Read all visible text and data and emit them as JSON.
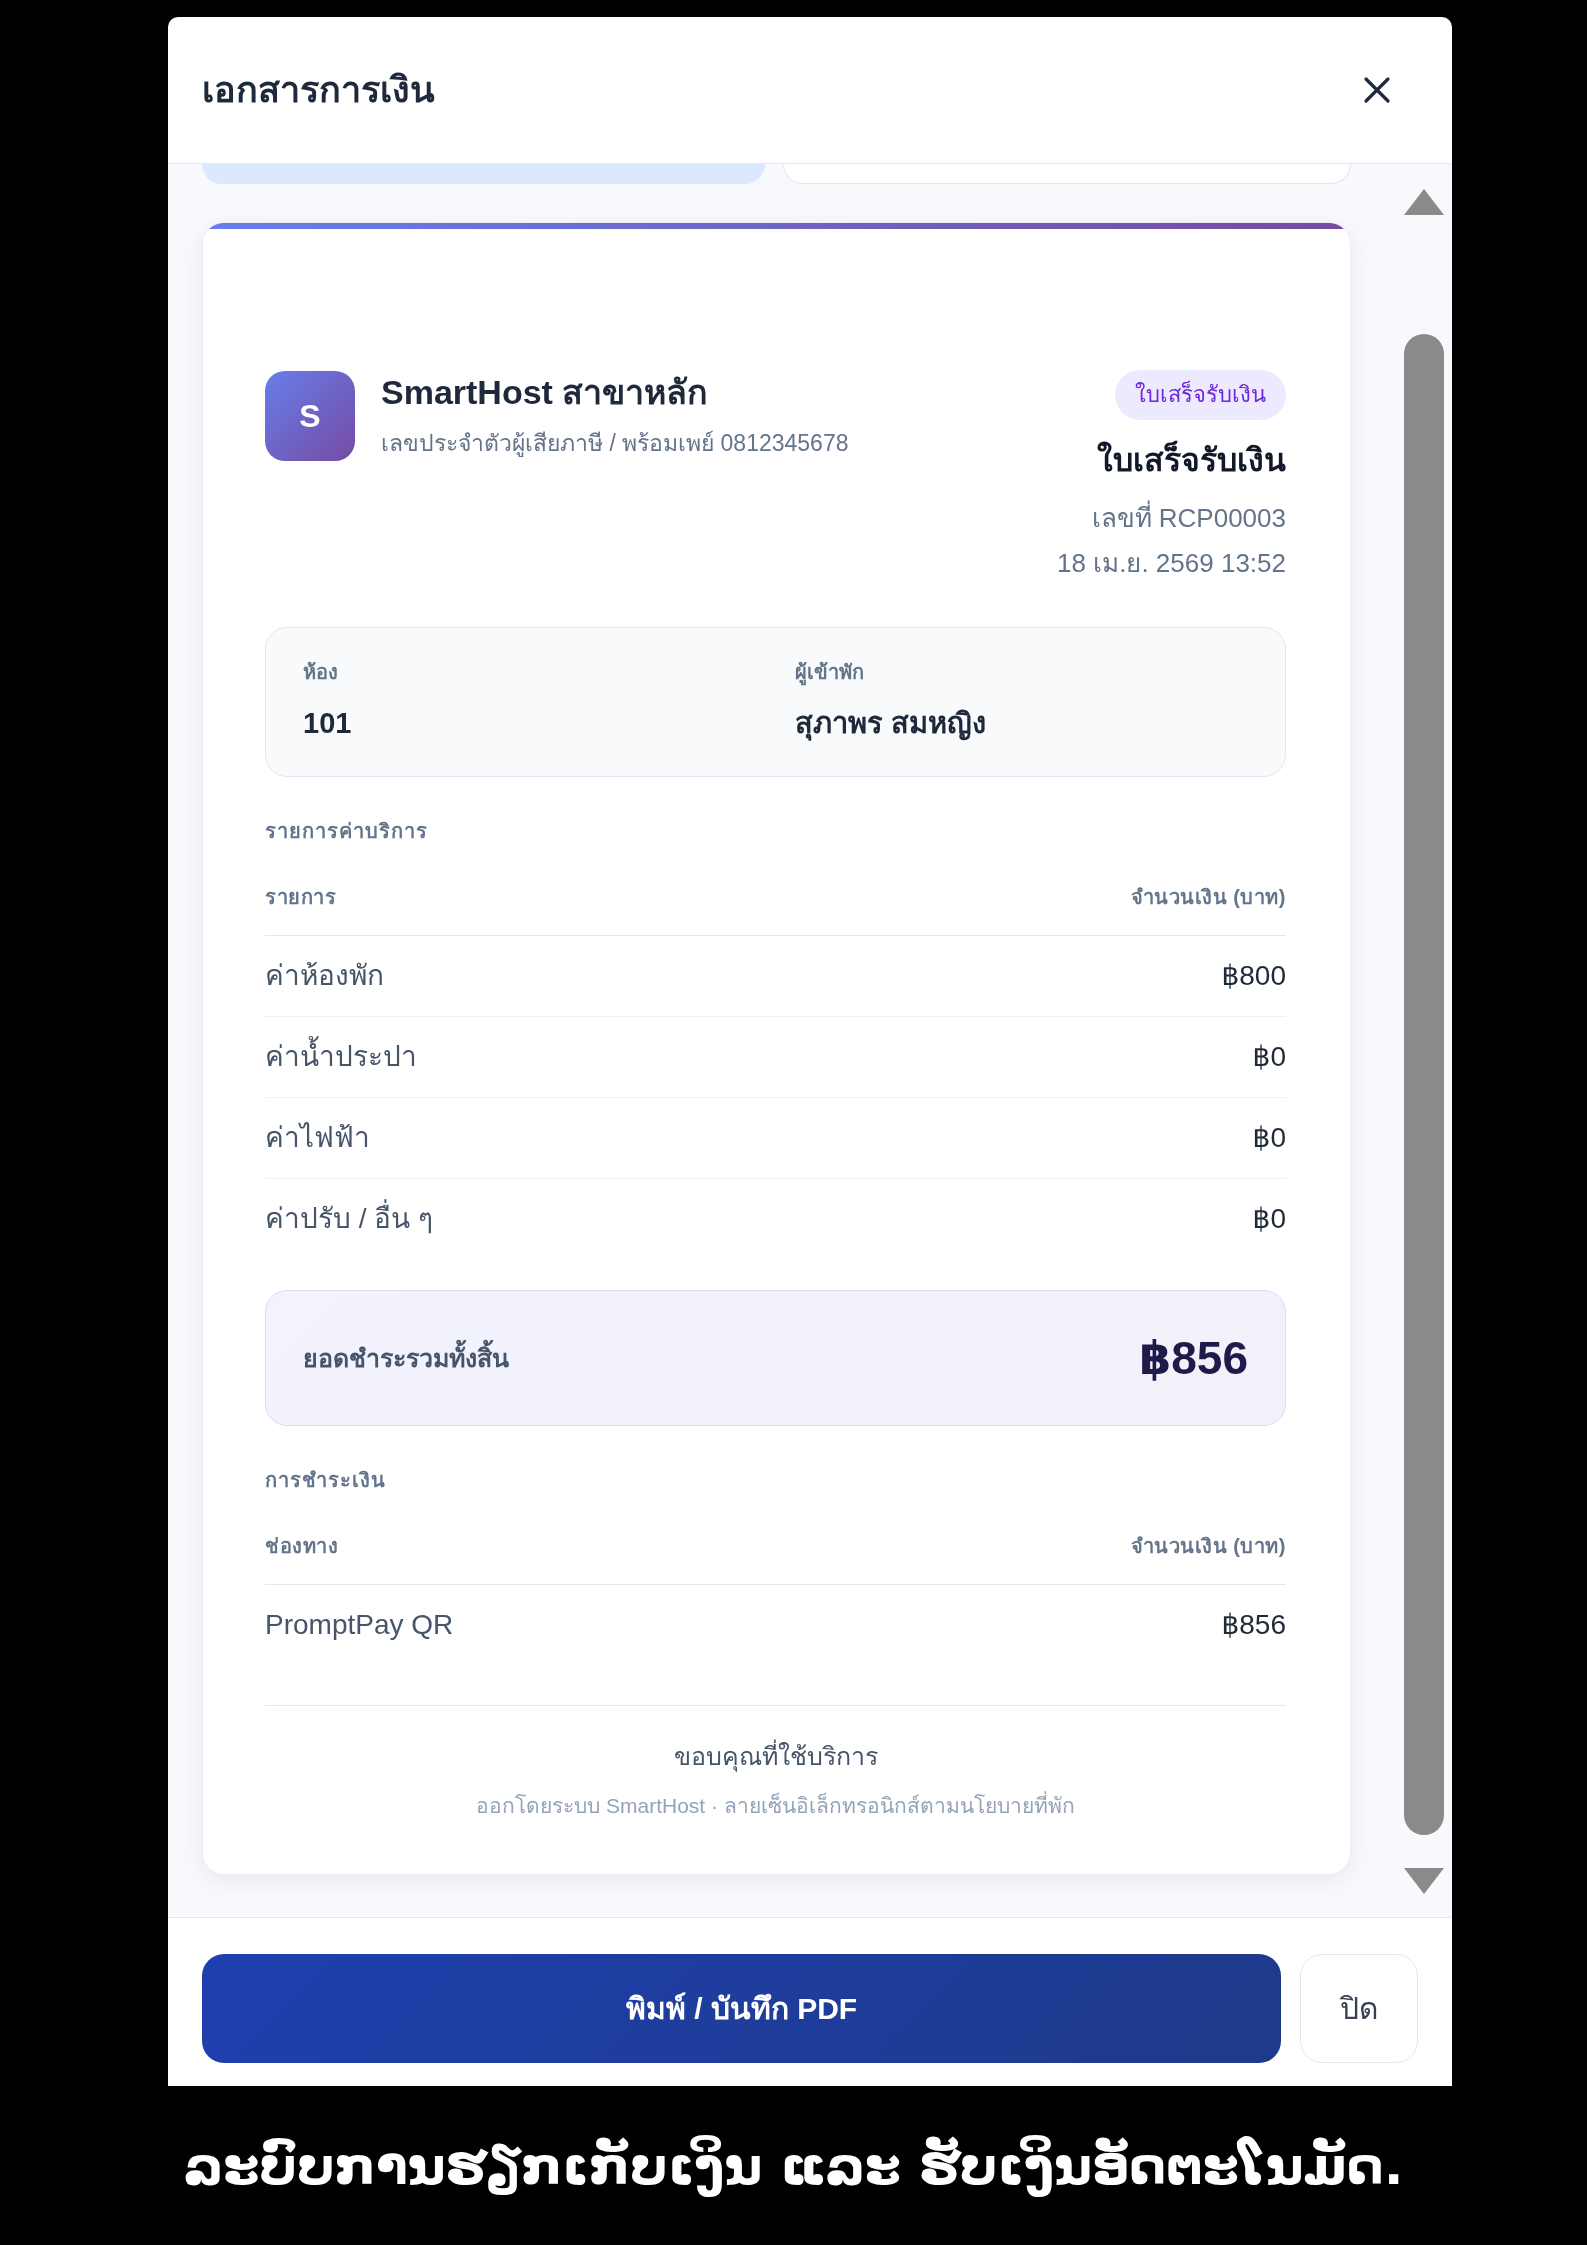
{
  "dialog": {
    "title": "เอกสารการเงิน"
  },
  "document_tabs": [
    {
      "selected": true
    },
    {
      "selected": false
    }
  ],
  "receipt": {
    "business": {
      "logo_letter": "S",
      "name": "SmartHost สาขาหลัก",
      "subtitle": "เลขประจำตัวผู้เสียภาษี / พร้อมเพย์ 0812345678"
    },
    "badge": "ใบเสร็จรับเงิน",
    "doc_title": "ใบเสร็จรับเงิน",
    "doc_number": "เลขที่ RCP00003",
    "doc_date": "18 เม.ย. 2569 13:52",
    "info": [
      {
        "label": "ห้อง",
        "value": "101"
      },
      {
        "label": "ผู้เข้าพัก",
        "value": "สุภาพร สมหญิง"
      }
    ],
    "charges": {
      "heading": "รายการค่าบริการ",
      "columns": [
        "รายการ",
        "จำนวนเงิน (บาท)"
      ],
      "rows": [
        {
          "item": "ค่าห้องพัก",
          "amount": "฿800"
        },
        {
          "item": "ค่าน้ำประปา",
          "amount": "฿0"
        },
        {
          "item": "ค่าไฟฟ้า",
          "amount": "฿0"
        },
        {
          "item": "ค่าปรับ / อื่น ๆ",
          "amount": "฿0"
        }
      ]
    },
    "total": {
      "label": "ยอดชำระรวมทั้งสิ้น",
      "amount": "฿856"
    },
    "payments": {
      "heading": "การชำระเงิน",
      "columns": [
        "ช่องทาง",
        "จำนวนเงิน (บาท)"
      ],
      "rows": [
        {
          "method": "PromptPay QR",
          "amount": "฿856"
        }
      ]
    },
    "thanks": "ขอบคุณที่ใช้บริการ",
    "issued_note": "ออกโดยระบบ SmartHost · ลายเซ็นอิเล็กทรอนิกส์ตามนโยบายที่พัก"
  },
  "footer": {
    "buttons": [
      {
        "label": "พิมพ์ / บันทึก PDF",
        "kind": "primary"
      },
      {
        "label": "ปิด",
        "kind": "secondary"
      }
    ]
  },
  "caption": "ລະບົບການຮຽກເກັບເງິນ ແລະ ຮັບເງິນອັດຕະໂນມັດ."
}
